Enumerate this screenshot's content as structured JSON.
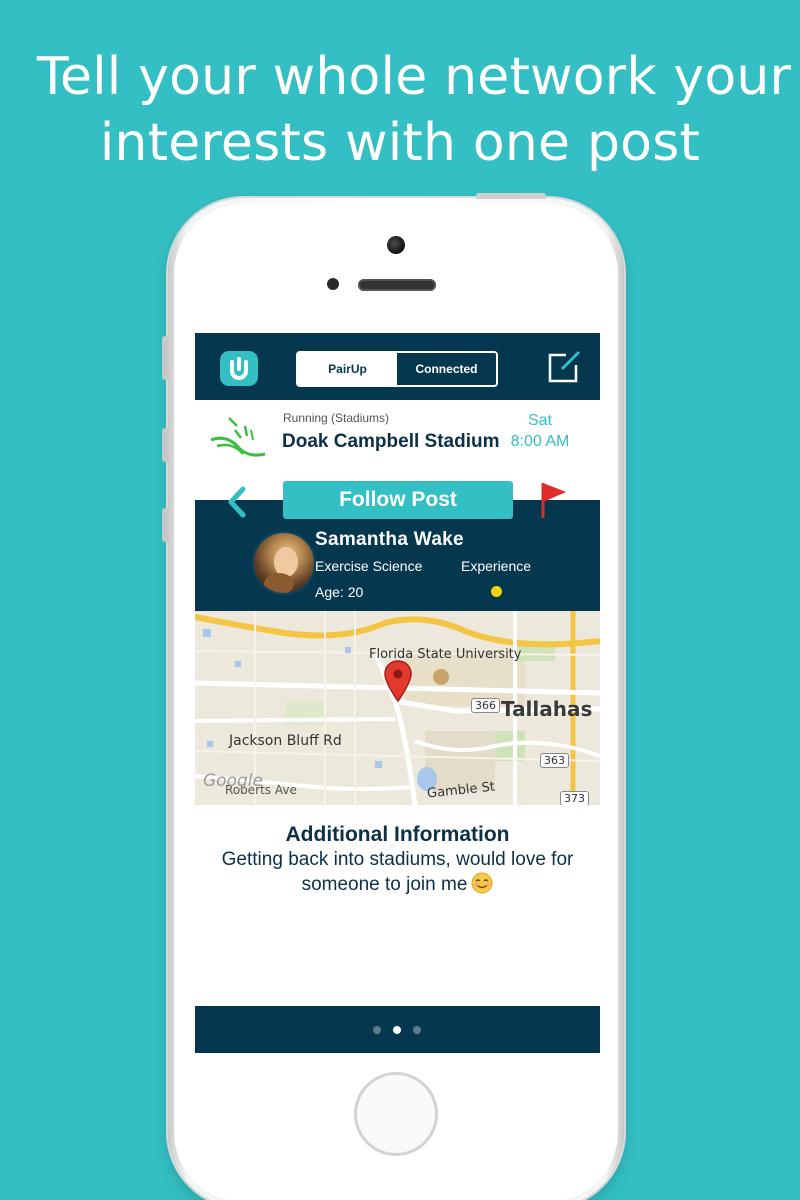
{
  "promo": {
    "headline_line1": "Tell your whole network your",
    "headline_line2": "interests with one post"
  },
  "navbar": {
    "segments": [
      {
        "label": "PairUp",
        "selected": true
      },
      {
        "label": "Connected",
        "selected": false
      }
    ]
  },
  "activity": {
    "category": "Running (Stadiums)",
    "place": "Doak Campbell Stadium",
    "day": "Sat",
    "time": "8:00 AM"
  },
  "post": {
    "follow_label": "Follow Post"
  },
  "user": {
    "name": "Samantha  Wake",
    "major": "Exercise Science",
    "experience_label": "Experience",
    "age": "Age: 20"
  },
  "map": {
    "labels": {
      "university": "Florida State University",
      "city": "Tallahas",
      "road1": "Jackson Bluff Rd",
      "road2": "Roberts Ave",
      "road3": "Gamble St",
      "route366": "366",
      "route363": "363",
      "route373": "373",
      "provider": "Google"
    }
  },
  "additional_info": {
    "title": "Additional Information",
    "body": "Getting back into stadiums, would love for someone to join me"
  },
  "pager": {
    "count": 3,
    "active_index": 1
  },
  "colors": {
    "background": "#33bfc3",
    "navy": "#05384f",
    "accent": "#33bfc3",
    "experience_dot": "#f5d20a",
    "flag": "#e02b2b"
  },
  "icons": [
    "app-logo-icon",
    "compose-icon",
    "running-icon",
    "back-chevron-icon",
    "flag-icon",
    "map-pin-icon",
    "smiley-emoji-icon"
  ]
}
